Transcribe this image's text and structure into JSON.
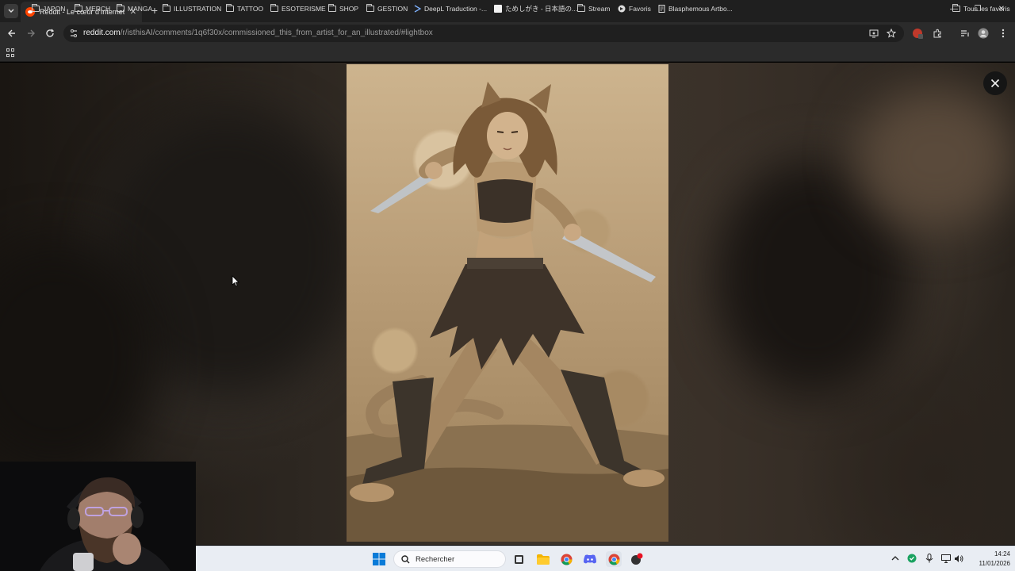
{
  "browser": {
    "tab": {
      "title": "Reddit - Le cœur d'Internet"
    },
    "address": {
      "domain": "reddit.com",
      "path": "/r/isthisAI/comments/1q6f30x/commissioned_this_from_artist_for_an_illustrated/#lightbox"
    },
    "bookmarks": [
      {
        "label": "JAPON",
        "icon": "folder-icon"
      },
      {
        "label": "MERCH",
        "icon": "folder-icon"
      },
      {
        "label": "MANGA",
        "icon": "folder-icon"
      },
      {
        "label": "ILLUSTRATION",
        "icon": "folder-icon"
      },
      {
        "label": "TATTOO",
        "icon": "folder-icon"
      },
      {
        "label": "ESOTERISME",
        "icon": "folder-icon"
      },
      {
        "label": "SHOP",
        "icon": "folder-icon"
      },
      {
        "label": "GESTION",
        "icon": "folder-icon"
      },
      {
        "label": "DeepL Traduction -...",
        "icon": "deepl-icon"
      },
      {
        "label": "ためしがき - 日本語の...",
        "icon": "page-icon"
      },
      {
        "label": "Stream",
        "icon": "folder-icon"
      },
      {
        "label": "Favoris",
        "icon": "globe-icon"
      },
      {
        "label": "Blasphemous Artbo...",
        "icon": "document-icon"
      }
    ],
    "all_bookmarks": "Tous les favoris"
  },
  "taskbar": {
    "search_placeholder": "Rechercher",
    "time": "14:24",
    "date": "11/01/2026"
  },
  "colors": {
    "reddit_orange": "#ff4500",
    "browser_chrome": "#2b2b2b",
    "taskbar": "#e9edf3"
  }
}
